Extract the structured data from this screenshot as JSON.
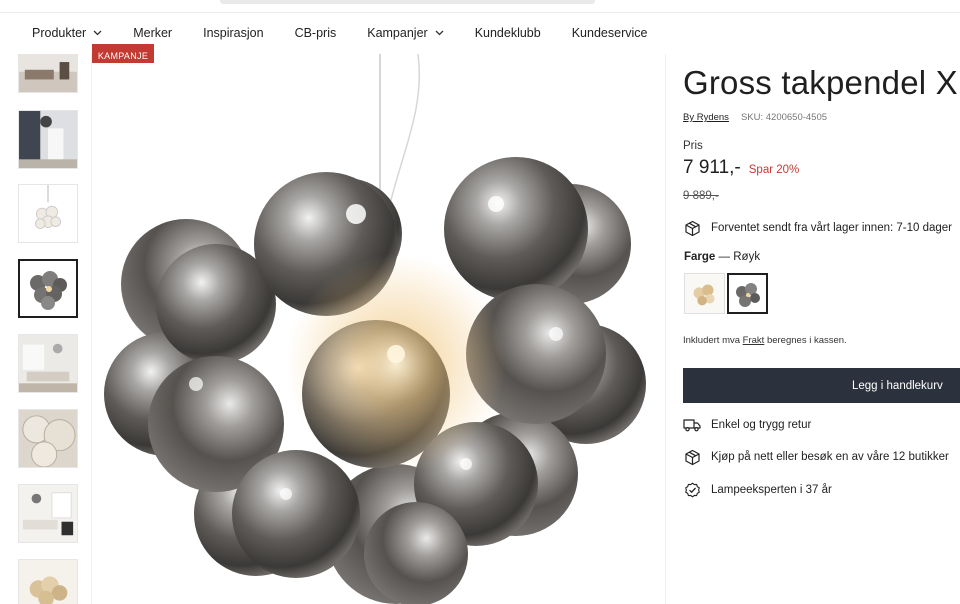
{
  "nav": {
    "items": [
      {
        "label": "Produkter",
        "dropdown": true
      },
      {
        "label": "Merker",
        "dropdown": false
      },
      {
        "label": "Inspirasjon",
        "dropdown": false
      },
      {
        "label": "CB-pris",
        "dropdown": false
      },
      {
        "label": "Kampanjer",
        "dropdown": true
      },
      {
        "label": "Kundeklubb",
        "dropdown": false
      },
      {
        "label": "Kundeservice",
        "dropdown": false
      }
    ]
  },
  "gallery": {
    "badge": "KAMPANJE",
    "thumbnails": [
      "room-interior",
      "room-dark-wall",
      "pendant-white",
      "pendant-smoke",
      "living-room",
      "glass-closeup",
      "bright-living-room",
      "pendant-gold"
    ],
    "active_thumbnail": 3
  },
  "product": {
    "title": "Gross takpendel XL",
    "brand": "By Rydens",
    "sku": "SKU: 4200650-4505",
    "price_label": "Pris",
    "price": "7 911,-",
    "save": "Spar 20%",
    "old_price": "9 889,-",
    "delivery": "Forventet sendt fra vårt lager innen: 7-10 dager",
    "color_label": "Farge",
    "color_sep": "—",
    "color_value": "Røyk",
    "vat_prefix": "Inkludert mva",
    "vat_link": "Frakt",
    "vat_suffix": "beregnes i kassen.",
    "add_to_cart": "Legg i handlekurv",
    "benefits": [
      {
        "icon": "truck-icon",
        "text": "Enkel og trygg retur"
      },
      {
        "icon": "box-icon",
        "text": "Kjøp på nett eller besøk en av våre 12 butikker"
      },
      {
        "icon": "check-badge-icon",
        "text": "Lampeeksperten i 37 år"
      }
    ]
  },
  "colors": {
    "accent_red": "#c23a32",
    "button_dark": "#2c323d"
  }
}
